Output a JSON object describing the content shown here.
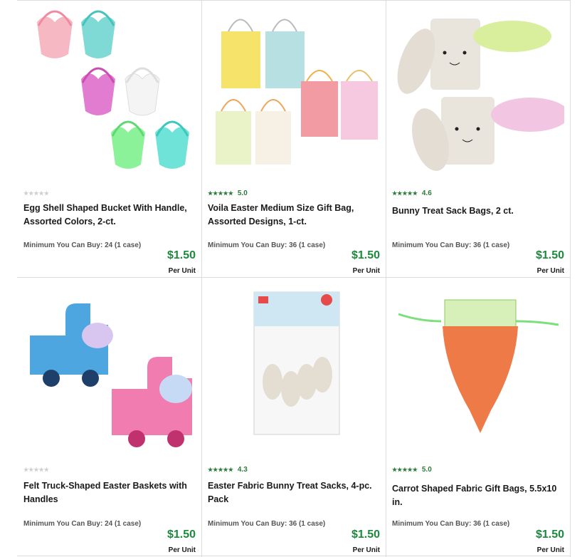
{
  "products": [
    {
      "title": "Egg Shell Shaped Bucket With Handle, Assorted Colors, 2-ct.",
      "rating": "",
      "stars": "★★★★★",
      "stars_empty": true,
      "min_buy": "Minimum You Can Buy: 24 (1 case)",
      "price": "$1.50",
      "per_unit": "Per Unit",
      "image": "pastel-egg-buckets"
    },
    {
      "title": "Voila Easter Medium Size Gift Bag, Assorted Designs, 1-ct.",
      "rating": "5.0",
      "stars": "★★★★★",
      "stars_empty": false,
      "min_buy": "Minimum You Can Buy: 36 (1 case)",
      "price": "$1.50",
      "per_unit": "Per Unit",
      "image": "easter-gift-bags"
    },
    {
      "title": "Bunny Treat Sack Bags, 2 ct.",
      "rating": "4.6",
      "stars": "★★★★★",
      "stars_empty": false,
      "min_buy": "Minimum You Can Buy: 36 (1 case)",
      "price": "$1.50",
      "per_unit": "Per Unit",
      "image": "bunny-sack-bags"
    },
    {
      "title": "Felt Truck-Shaped Easter Baskets with Handles",
      "rating": "",
      "stars": "★★★★★",
      "stars_empty": true,
      "min_buy": "Minimum You Can Buy: 24 (1 case)",
      "price": "$1.50",
      "per_unit": "Per Unit",
      "image": "felt-truck-baskets"
    },
    {
      "title": "Easter Fabric Bunny Treat Sacks, 4-pc. Pack",
      "rating": "4.3",
      "stars": "★★★★★",
      "stars_empty": false,
      "min_buy": "Minimum You Can Buy: 36 (1 case)",
      "price": "$1.50",
      "per_unit": "Per Unit",
      "image": "bunny-treat-sacks-pack"
    },
    {
      "title": "Carrot Shaped Fabric Gift Bags, 5.5x10 in.",
      "rating": "5.0",
      "stars": "★★★★★",
      "stars_empty": false,
      "min_buy": "Minimum You Can Buy: 36 (1 case)",
      "price": "$1.50",
      "per_unit": "Per Unit",
      "image": "carrot-gift-bag"
    }
  ],
  "colors": {
    "price": "#1c8a3c",
    "rating": "#2d7d3a",
    "divider": "#dcdcdc"
  }
}
